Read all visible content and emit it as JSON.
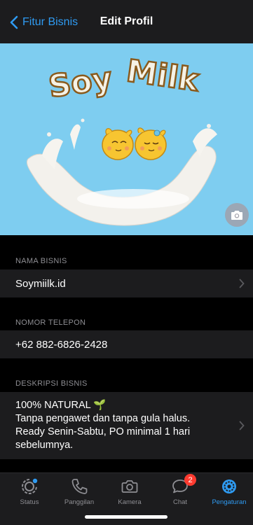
{
  "nav": {
    "back_label": "Fitur Bisnis",
    "title": "Edit Profil"
  },
  "cover": {
    "logo_text": "Soy Milk"
  },
  "sections": {
    "business_name": {
      "label": "NAMA BISNIS",
      "value": "Soymiilk.id"
    },
    "phone": {
      "label": "NOMOR TELEPON",
      "value": "+62 882-6826-2428"
    },
    "description": {
      "label": "DESKRIPSI BISNIS",
      "line1": "100% NATURAL 🌱",
      "line2": "Tanpa pengawet dan tanpa gula halus.",
      "line3": "Ready Senin-Sabtu, PO minimal 1 hari",
      "line4": "sebelumnya."
    }
  },
  "tabbar": {
    "tabs": [
      {
        "label": "Status",
        "icon": "status-icon"
      },
      {
        "label": "Panggilan",
        "icon": "phone-icon"
      },
      {
        "label": "Kamera",
        "icon": "camera-icon"
      },
      {
        "label": "Chat",
        "icon": "chat-icon",
        "badge": "2"
      },
      {
        "label": "Pengaturan",
        "icon": "settings-icon",
        "active": true
      }
    ]
  },
  "colors": {
    "accent": "#2f9bf2",
    "cover_bg": "#7ecdf0",
    "badge": "#ff3b30"
  }
}
